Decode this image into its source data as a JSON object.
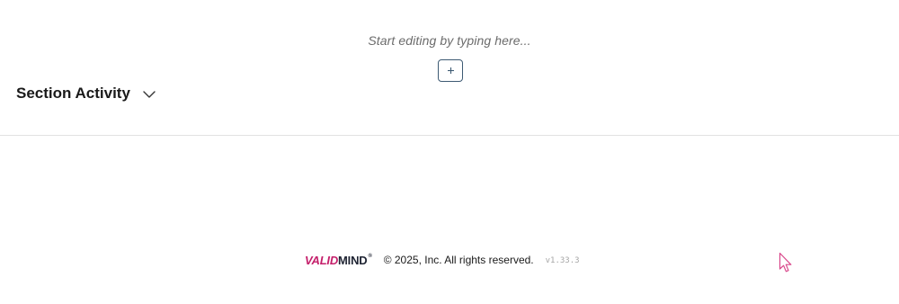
{
  "editor": {
    "placeholder": "Start editing by typing here...",
    "add_block_icon": "plus-icon"
  },
  "section": {
    "title": "Section Activity",
    "toggle_icon": "chevron-down-icon"
  },
  "footer": {
    "logo_part1": "VALID",
    "logo_part2": "MIND",
    "logo_mark": "®",
    "copyright": "© 2025, Inc. All rights reserved.",
    "version": "v1.33.3"
  },
  "colors": {
    "brand_pink": "#c41e6a",
    "brand_dark": "#1f2433",
    "button_border": "#3d5a73",
    "divider": "#e2e2e2"
  },
  "cursor_icon": "mouse-pointer-icon"
}
